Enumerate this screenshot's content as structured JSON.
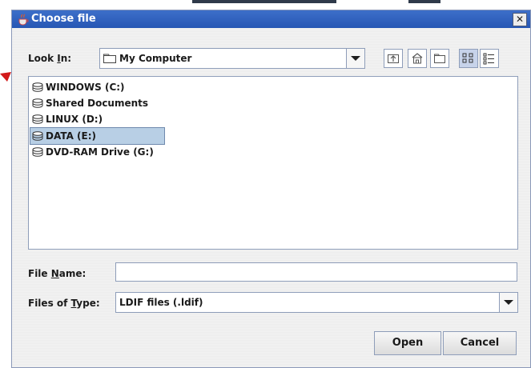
{
  "window": {
    "title": "Choose file",
    "close_glyph": "✕"
  },
  "look_in": {
    "label_pre": "Look ",
    "label_mnemonic": "I",
    "label_post": "n:",
    "value": "My Computer",
    "folder_icon": "folder-icon"
  },
  "toolbar": {
    "icons": [
      "up-one-level-icon",
      "home-icon",
      "new-folder-icon",
      "list-view-icon",
      "details-view-icon"
    ]
  },
  "files": [
    {
      "label": "WINDOWS (C:)",
      "selected": false,
      "icon": "drive-icon"
    },
    {
      "label": "Shared Documents",
      "selected": false,
      "icon": "drive-icon"
    },
    {
      "label": "LINUX (D:)",
      "selected": false,
      "icon": "drive-icon"
    },
    {
      "label": "DATA (E:)",
      "selected": true,
      "icon": "drive-icon"
    },
    {
      "label": "DVD-RAM Drive (G:)",
      "selected": false,
      "icon": "drive-icon"
    }
  ],
  "file_name": {
    "label_pre": "File ",
    "label_mnemonic": "N",
    "label_post": "ame:",
    "value": ""
  },
  "file_type": {
    "label_pre": "Files of ",
    "label_mnemonic": "T",
    "label_post": "ype:",
    "value": "LDIF files (.ldif)"
  },
  "buttons": {
    "open": "Open",
    "cancel": "Cancel"
  },
  "colors": {
    "title_bar": "#2f5fbf",
    "selection": "#b8cfe5",
    "annotation_arrow": "#d21a1a"
  }
}
